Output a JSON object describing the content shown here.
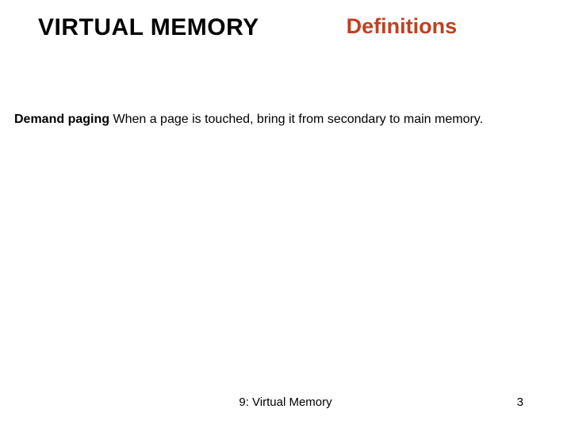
{
  "header": {
    "title": "VIRTUAL MEMORY",
    "subtitle": "Definitions"
  },
  "content": {
    "term": "Demand paging",
    "definition": "  When a page is touched, bring it from secondary to main memory."
  },
  "footer": {
    "label": "9: Virtual Memory",
    "page": "3"
  }
}
